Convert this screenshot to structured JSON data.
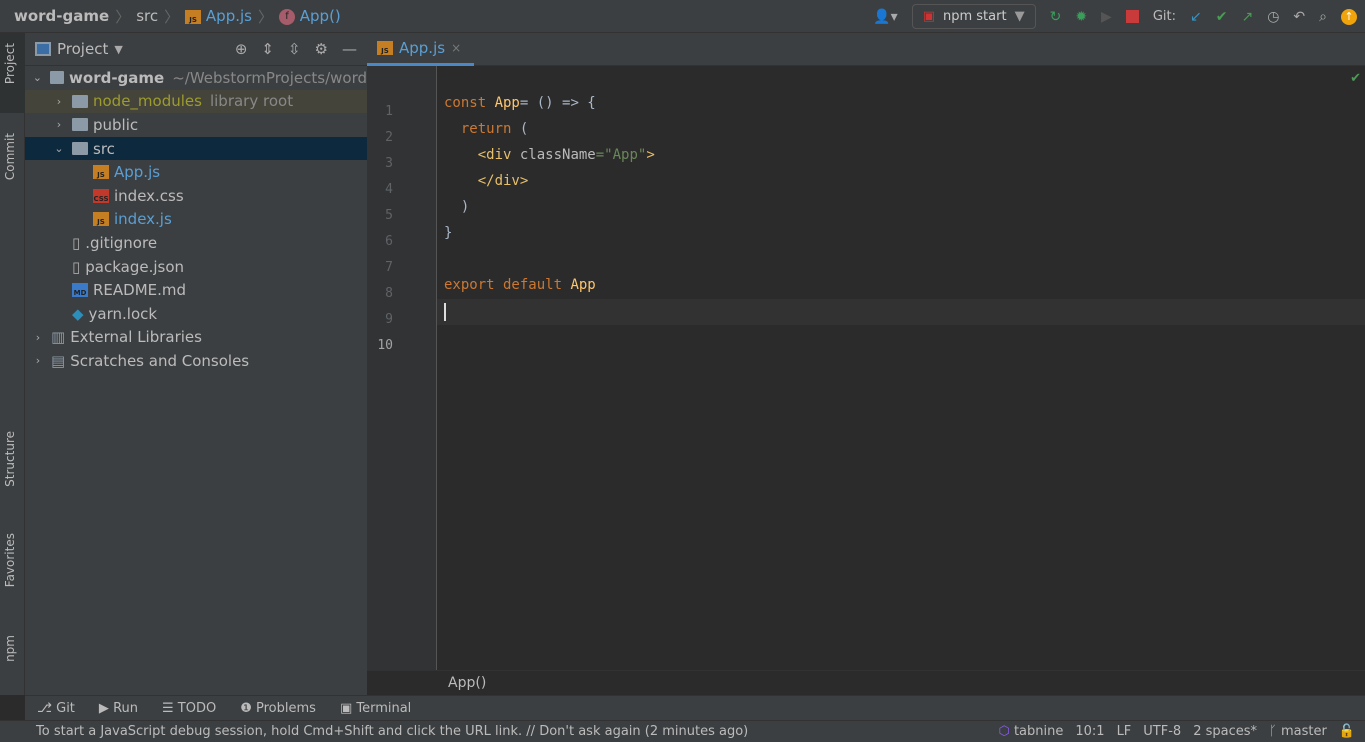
{
  "breadcrumb": {
    "project": "word-game",
    "folder": "src",
    "file": "App.js",
    "symbol": "App()"
  },
  "toolbar": {
    "run_config": "npm start",
    "git_label": "Git:"
  },
  "sidebar_tabs": [
    "Project",
    "Commit",
    "Structure",
    "Favorites",
    "npm"
  ],
  "project_panel": {
    "title": "Project",
    "tree": [
      {
        "label": "word-game",
        "hint": "~/WebstormProjects/word",
        "level": 0,
        "type": "folder",
        "expanded": true
      },
      {
        "label": "node_modules",
        "hint": "library root",
        "level": 1,
        "type": "folder",
        "expanded": false
      },
      {
        "label": "public",
        "level": 1,
        "type": "folder",
        "expanded": false
      },
      {
        "label": "src",
        "level": 1,
        "type": "folder",
        "expanded": true,
        "selected": true
      },
      {
        "label": "App.js",
        "level": 2,
        "type": "js"
      },
      {
        "label": "index.css",
        "level": 2,
        "type": "css"
      },
      {
        "label": "index.js",
        "level": 2,
        "type": "js"
      },
      {
        "label": ".gitignore",
        "level": 1,
        "type": "file"
      },
      {
        "label": "package.json",
        "level": 1,
        "type": "file"
      },
      {
        "label": "README.md",
        "level": 1,
        "type": "md"
      },
      {
        "label": "yarn.lock",
        "level": 1,
        "type": "yarn"
      },
      {
        "label": "External Libraries",
        "level": 0,
        "type": "lib"
      },
      {
        "label": "Scratches and Consoles",
        "level": 0,
        "type": "scratch"
      }
    ]
  },
  "editor": {
    "tab": "App.js",
    "breadcrumb": "App()",
    "lines": [
      [],
      [
        [
          "kw",
          "const "
        ],
        [
          "fn",
          "App"
        ],
        [
          "",
          "= () => {"
        ]
      ],
      [
        [
          "",
          "  "
        ],
        [
          "kw",
          "return"
        ],
        [
          "",
          " ("
        ]
      ],
      [
        [
          "",
          "    "
        ],
        [
          "tag",
          "<div "
        ],
        [
          "attr",
          "className"
        ],
        [
          "str",
          "=\"App\""
        ],
        [
          "tag",
          ">"
        ]
      ],
      [
        [
          "",
          "    "
        ],
        [
          "tag",
          "</div>"
        ]
      ],
      [
        [
          "",
          "  )"
        ]
      ],
      [
        [
          "",
          "}"
        ]
      ],
      [],
      [
        [
          "kw",
          "export default "
        ],
        [
          "fn",
          "App"
        ]
      ],
      []
    ]
  },
  "bottom_tools": [
    "Git",
    "Run",
    "TODO",
    "Problems",
    "Terminal"
  ],
  "status": {
    "message": "To start a JavaScript debug session, hold Cmd+Shift and click the URL link. // Don't ask again (2 minutes ago)",
    "plugin": "tabnine",
    "position": "10:1",
    "line_sep": "LF",
    "encoding": "UTF-8",
    "indent": "2 spaces*",
    "branch": "master"
  }
}
